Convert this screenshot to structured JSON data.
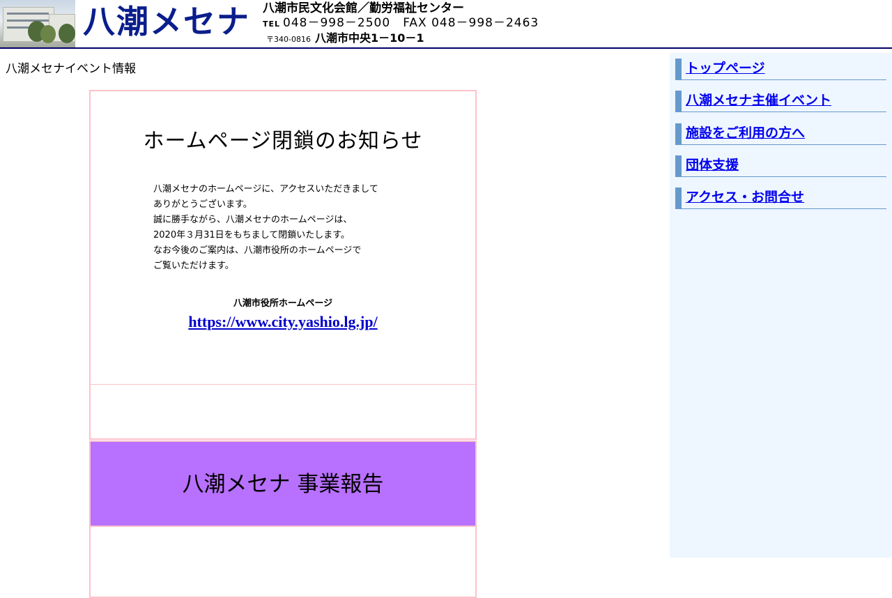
{
  "header": {
    "logo_text": "八潮メセナ",
    "organization": "八潮市民文化会館／勤労福祉センター",
    "tel_label": "TEL",
    "contact": "048－998－2500　FAX 048－998－2463",
    "postal": "〒340-0816",
    "address": "八潮市中央1－10－1"
  },
  "main": {
    "page_heading": "八潮メセナイベント情報",
    "notice": {
      "title": "ホームページ閉鎖のお知らせ",
      "body_lines": [
        "八潮メセナのホームページに、アクセスいただきまして",
        "ありがとうございます。",
        "誠に勝手ながら、八潮メセナのホームページは、",
        "2020年３月31日をもちまして閉鎖いたします。",
        "なお今後のご案内は、八潮市役所のホームページで",
        "ご覧いただけます。"
      ],
      "link_label": "八潮市役所ホームページ",
      "link_url": "https://www.city.yashio.lg.jp/"
    },
    "report": {
      "title": "八潮メセナ 事業報告"
    }
  },
  "sidebar": {
    "items": [
      {
        "label": "トップページ"
      },
      {
        "label": "八潮メセナ主催イベント"
      },
      {
        "label": "施設をご利用の方へ"
      },
      {
        "label": "団体支援"
      },
      {
        "label": "アクセス・お問合せ"
      }
    ]
  },
  "colors": {
    "logo": "#0a1e8c",
    "header_rule": "#000066",
    "cell_border": "#ffc0cb",
    "report_bg": "#b870ff",
    "sidebar_bg": "#eef6ff",
    "nav_accent": "#6699cc",
    "link": "#0000ee"
  }
}
